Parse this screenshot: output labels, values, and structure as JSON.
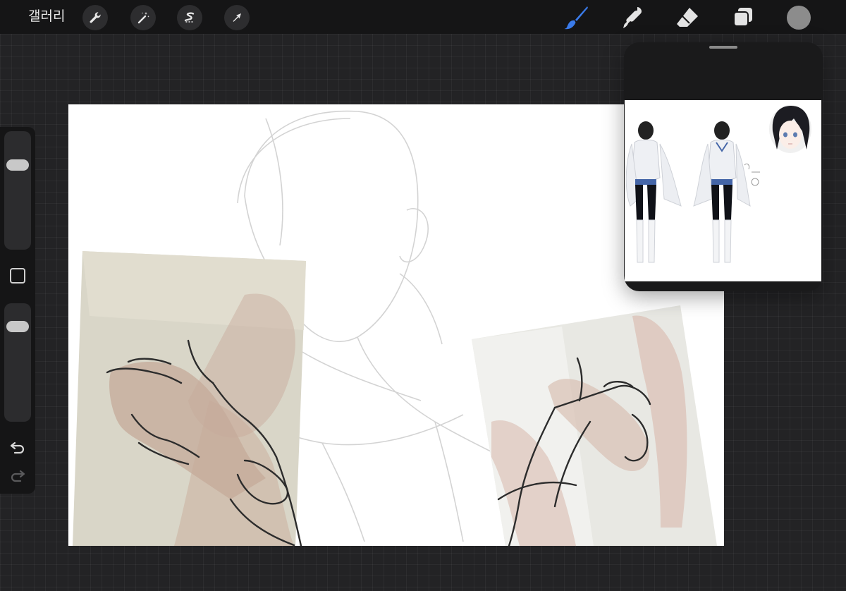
{
  "toolbar": {
    "gallery_label": "갤러리",
    "left_tools": [
      "wrench-icon",
      "magic-wand-icon",
      "selection-icon",
      "transform-arrow-icon"
    ],
    "right_tools": [
      "brush-icon",
      "smudge-icon",
      "eraser-icon",
      "layers-icon"
    ],
    "active_tool": "brush-icon",
    "accent_color": "#3a7bea",
    "current_color": "#8c8c8c"
  },
  "sidebar": {
    "brush_size_level": 0.75,
    "opacity_level": 0.85,
    "icons": [
      "modify-square-icon",
      "undo-icon",
      "redo-icon"
    ]
  },
  "reference_window": {
    "background": "#1a1a1b"
  }
}
